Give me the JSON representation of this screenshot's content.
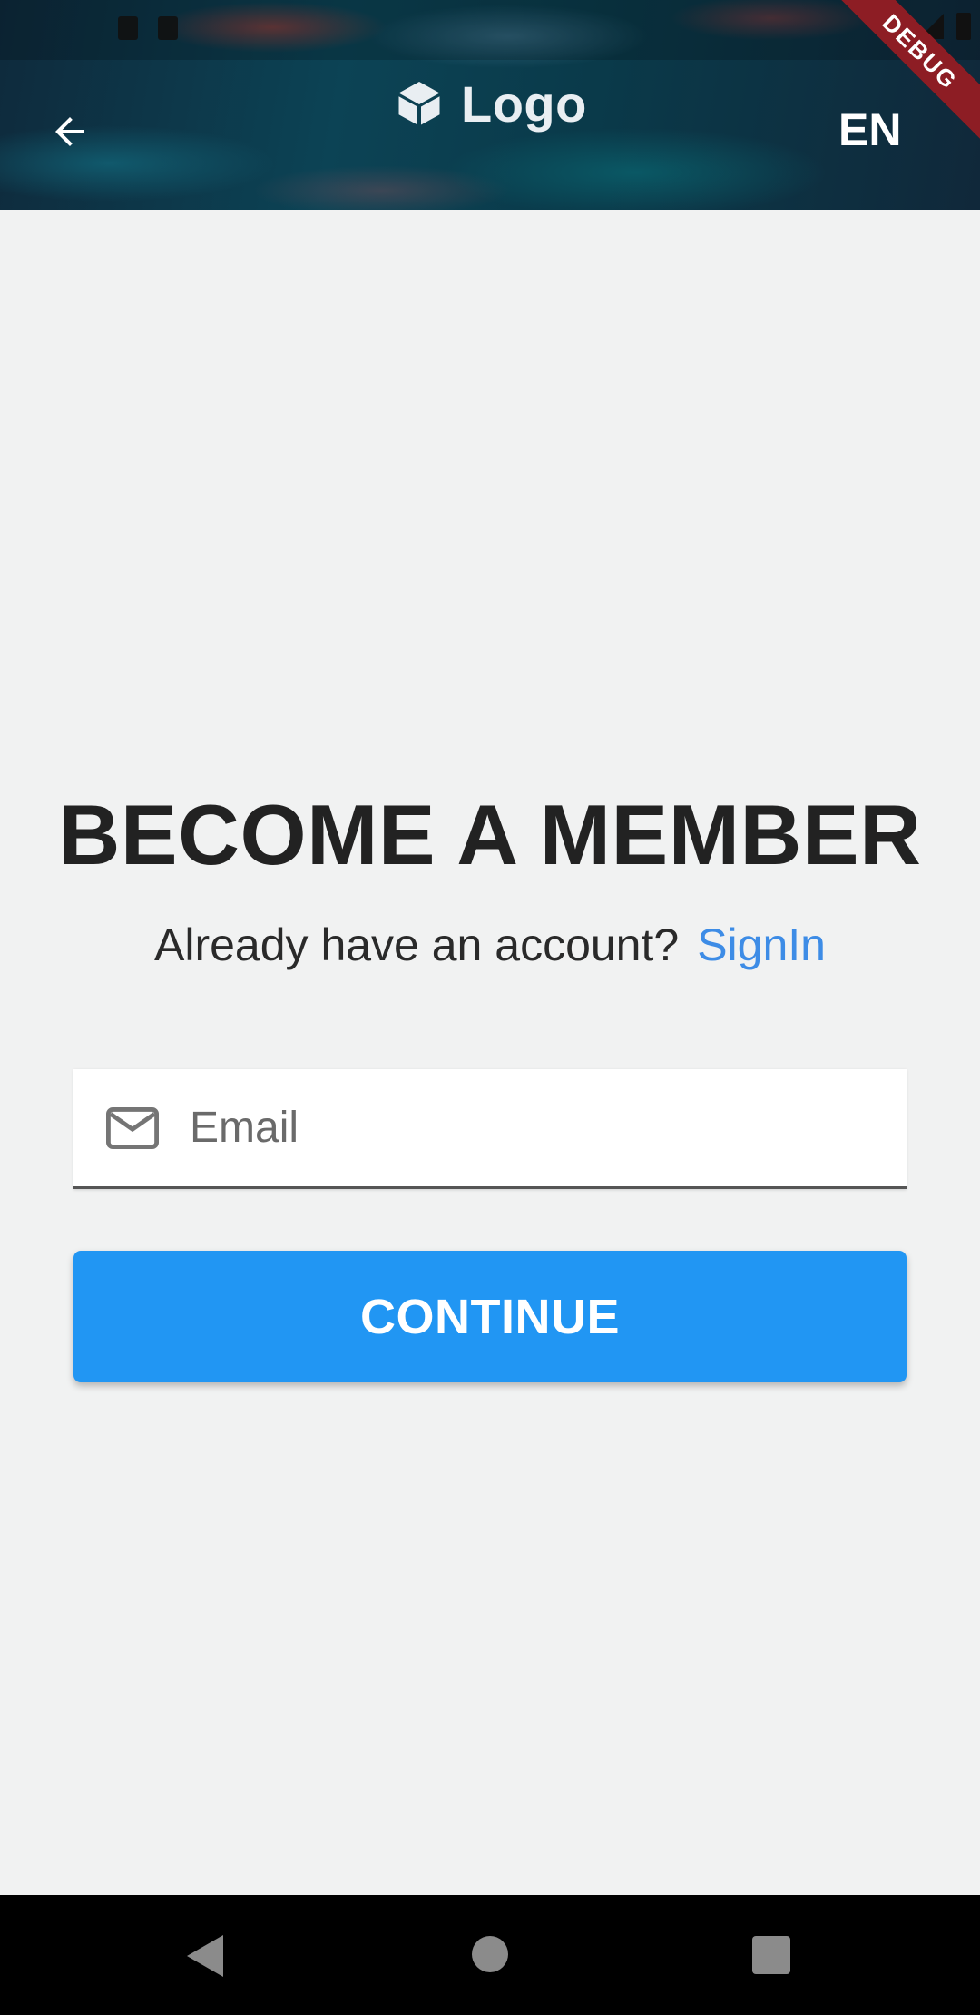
{
  "header": {
    "logo_text": "Logo",
    "language": "EN",
    "debug_banner": "DEBUG"
  },
  "main": {
    "title": "BECOME A MEMBER",
    "account_prompt": "Already have an account?",
    "signin_link": "SignIn",
    "email": {
      "placeholder": "Email",
      "value": ""
    },
    "continue_label": "CONTINUE"
  },
  "colors": {
    "accent": "#2196f3",
    "link": "#3d8ce6",
    "title": "#222222",
    "background": "#f1f2f2",
    "debug_ribbon": "#8d1d24"
  },
  "icons": {
    "back": "arrow-back-icon",
    "logo": "cube-icon",
    "email": "mail-icon",
    "nav": [
      "triangle-back-icon",
      "circle-home-icon",
      "square-recents-icon"
    ]
  }
}
